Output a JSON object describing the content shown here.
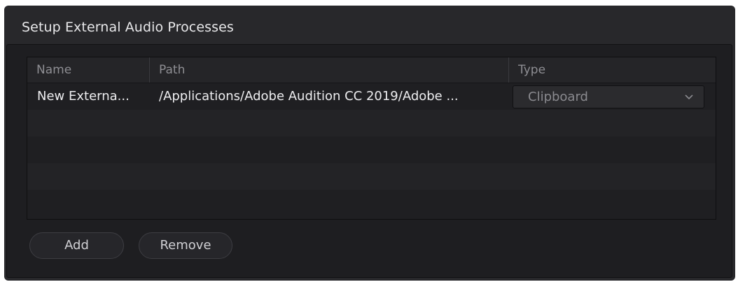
{
  "dialog": {
    "title": "Setup External Audio Processes"
  },
  "table": {
    "columns": [
      "Name",
      "Path",
      "Type"
    ],
    "rows": [
      {
        "name": "New Externa...",
        "path": "/Applications/Adobe Audition CC 2019/Adobe ...",
        "type": "Clipboard"
      }
    ]
  },
  "buttons": {
    "add_label": "Add",
    "remove_label": "Remove"
  },
  "icons": {
    "type_dropdown": "chevron-down-icon"
  },
  "colors": {
    "window_bg": "#28282b",
    "panel_bg": "#1e1e21",
    "header_bg": "#252528",
    "text": "#eeeef0",
    "muted_text": "#8e8e93"
  }
}
